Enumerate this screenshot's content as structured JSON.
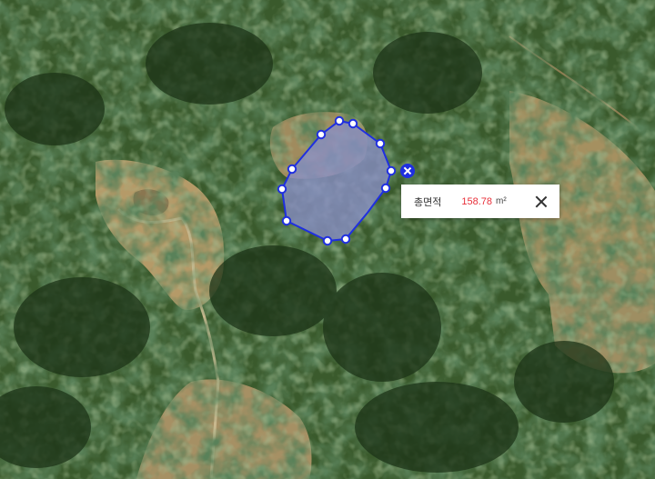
{
  "map": {
    "type": "satellite",
    "measure_color": "#1f2fe0",
    "fill_color": "#8a90c8"
  },
  "measurement": {
    "label": "총면적",
    "value": "158.78",
    "unit": "m²",
    "value_color": "#e8303a"
  },
  "icons": {
    "delete": "close-circle-icon",
    "close": "close-icon"
  }
}
